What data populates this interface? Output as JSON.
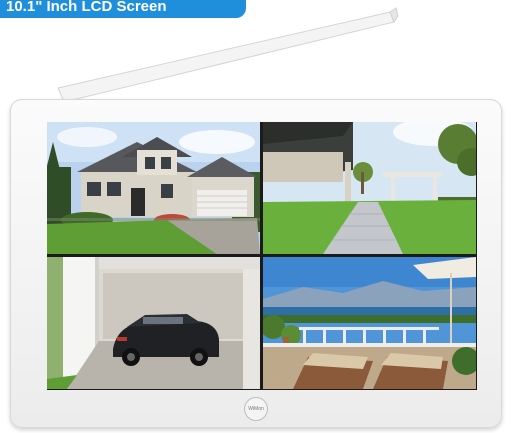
{
  "badge": {
    "text": "10.1\" Inch LCD Screen",
    "color": "#1f8fdc"
  },
  "monitor": {
    "logo_text": "WiMon",
    "feeds": [
      {
        "name": "house-front"
      },
      {
        "name": "garden-patio"
      },
      {
        "name": "garage-car"
      },
      {
        "name": "terrace-lake"
      }
    ]
  }
}
